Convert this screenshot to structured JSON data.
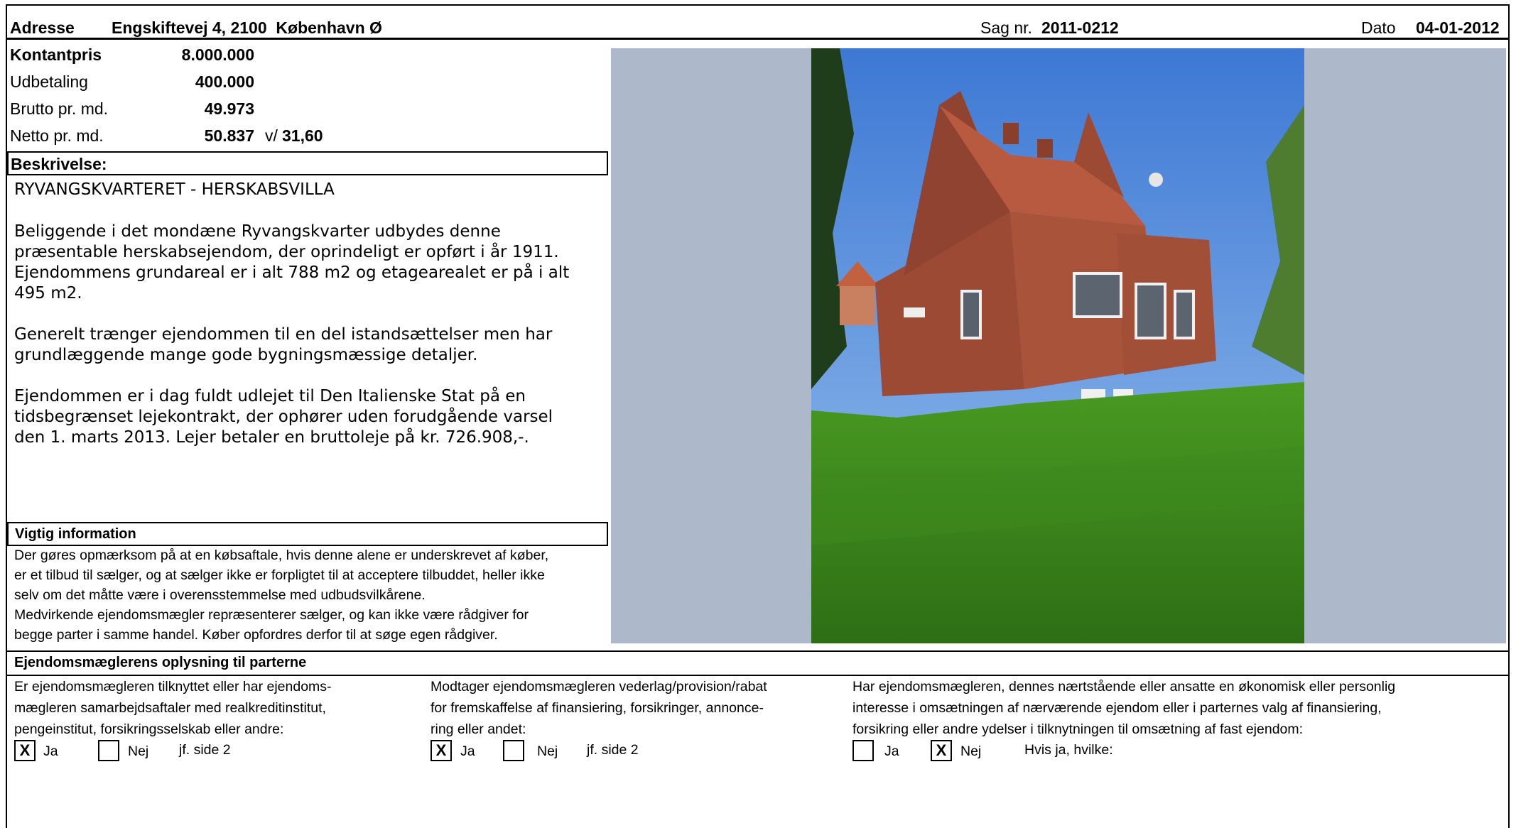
{
  "header": {
    "address_label": "Adresse",
    "address_value": "Engskiftevej 4, 2100  København Ø",
    "case_label": "Sag nr.",
    "case_value": "2011-0212",
    "date_label": "Dato",
    "date_value": "04-01-2012"
  },
  "prices": [
    {
      "label": "Kontantpris",
      "value": "8.000.000"
    },
    {
      "label": "Udbetaling",
      "value": "400.000"
    },
    {
      "label": "Brutto pr. md.",
      "value": "49.973"
    },
    {
      "label": "Netto pr. md.",
      "value": "50.837"
    }
  ],
  "netto_suffix_label": "v/",
  "netto_suffix_value": "31,60",
  "description": {
    "heading": "Beskrivelse:",
    "title": "RYVANGSKVARTERET - HERSKABSVILLA",
    "paragraphs": [
      "Beliggende i det mondæne Ryvangskvarter udbydes denne\npræsentable herskabsejendom, der oprindeligt er opført i år 1911.\nEjendommens grundareal er i alt 788 m2 og etagearealet er på i alt\n495 m2.",
      "Generelt trænger ejendommen til en del istandsættelser men har\ngrundlæggende mange gode bygningsmæssige detaljer.",
      "Ejendommen er i dag fuldt udlejet til Den Italienske Stat på en\ntidsbegrænset lejekontrakt, der ophører uden forudgående varsel\nden 1. marts 2013. Lejer betaler en bruttoleje på kr. 726.908,-."
    ]
  },
  "important": {
    "heading": "Vigtig information",
    "lines": [
      "Der gøres opmærksom på at en købsaftale, hvis denne alene er underskrevet af køber,",
      "er et tilbud til sælger, og at sælger ikke er forpligtet til at acceptere tilbuddet, heller ikke",
      "selv om det måtte være i overensstemmelse med udbudsvilkårene.",
      "Medvirkende ejendomsmægler repræsenterer sælger, og kan ikke være rådgiver for",
      "begge parter i samme handel. Køber opfordres derfor til at søge egen rådgiver."
    ]
  },
  "broker": {
    "heading": "Ejendomsmæglerens oplysning til parterne",
    "columns": [
      {
        "lines": [
          "Er ejendomsmægleren tilknyttet eller har ejendoms-",
          "mægleren samarbejdsaftaler med realkreditinstitut,",
          "pengeinstitut, forsikringsselskab eller andre:"
        ],
        "ja_mark": "X",
        "ja_label": "Ja",
        "nej_mark": "",
        "nej_label": "Nej",
        "note": "jf. side 2"
      },
      {
        "lines": [
          "Modtager ejendomsmægleren vederlag/provision/rabat",
          "for fremskaffelse af finansiering, forsikringer, annonce-",
          "ring eller andet:"
        ],
        "ja_mark": "X",
        "ja_label": "Ja",
        "nej_mark": "",
        "nej_label": "Nej",
        "note": "jf. side 2"
      },
      {
        "lines": [
          "Har ejendomsmægleren, dennes nærtstående eller ansatte en økonomisk eller personlig",
          "interesse i omsætningen af nærværende ejendom eller i parternes valg af finansiering,",
          "forsikring eller andre ydelser i tilknytningen til omsætning af fast ejendom:"
        ],
        "ja_mark": "",
        "ja_label": "Ja",
        "nej_mark": "X",
        "nej_label": "Nej",
        "note": "Hvis ja, hvilke:"
      }
    ]
  },
  "colors": {
    "photo_background": "#adb9cb",
    "sky": "#4d86d8",
    "grass": "#3f8f1e",
    "brick": "#9c4a33",
    "roof": "#b85a3f"
  }
}
